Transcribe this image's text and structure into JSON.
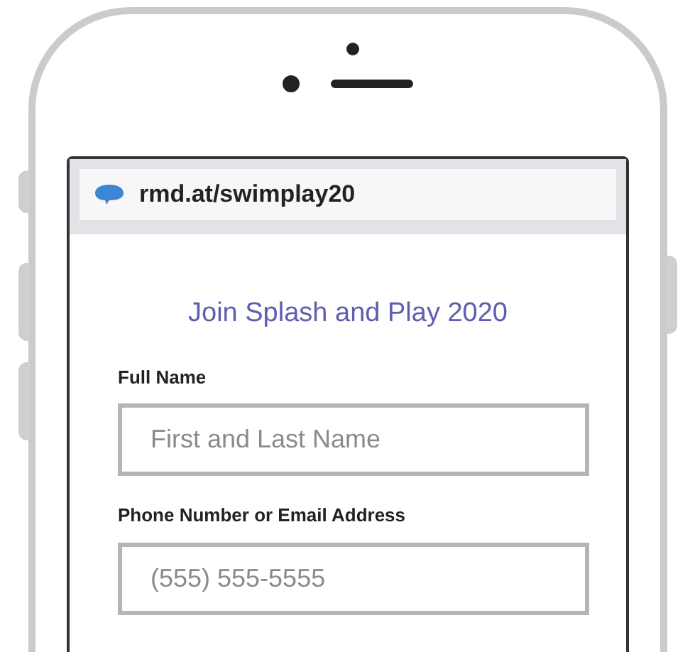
{
  "browser": {
    "url": "rmd.at/swimplay20"
  },
  "form": {
    "title": "Join Splash and Play 2020",
    "fields": [
      {
        "label": "Full Name",
        "placeholder": "First and Last Name"
      },
      {
        "label": "Phone Number or Email Address",
        "placeholder": "(555) 555-5555"
      }
    ]
  }
}
